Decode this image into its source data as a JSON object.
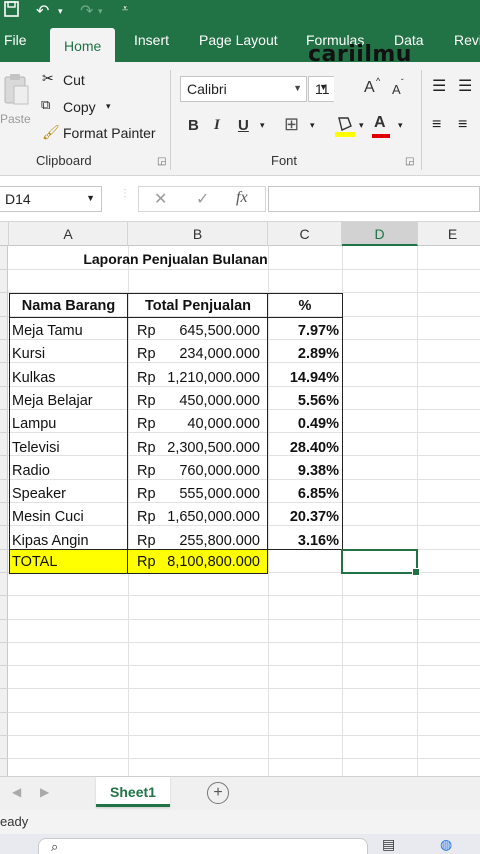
{
  "titlebar": {
    "save_icon": "save-icon",
    "undo_icon": "undo-icon",
    "redo_icon": "redo-icon",
    "customize_icon": "customize-qat-icon"
  },
  "tabs": [
    {
      "label": "File"
    },
    {
      "label": "Home"
    },
    {
      "label": "Insert"
    },
    {
      "label": "Page Layout"
    },
    {
      "label": "Formulas"
    },
    {
      "label": "Data"
    },
    {
      "label": "Revi"
    }
  ],
  "watermark": "cariilmu",
  "clipboard": {
    "paste_label": "Paste",
    "cut_label": "Cut",
    "copy_label": "Copy",
    "format_painter_label": "Format Painter",
    "group_label": "Clipboard"
  },
  "font": {
    "family": "Calibri",
    "size": "11",
    "grow_label": "A",
    "shrink_label": "A",
    "bold_label": "B",
    "italic_label": "I",
    "underline_label": "U",
    "font_color_label": "A",
    "group_label": "Font"
  },
  "formula_bar": {
    "name_box": "D14",
    "cancel_symbol": "✕",
    "enter_symbol": "✓",
    "fx_symbol": "fx",
    "value": ""
  },
  "columns": [
    "A",
    "B",
    "C",
    "D",
    "E"
  ],
  "sheet": {
    "title": "Laporan Penjualan Bulanan",
    "headers": {
      "name": "Nama Barang",
      "total": "Total Penjualan",
      "pct": "%"
    },
    "currency": "Rp",
    "rows": [
      {
        "name": "Meja Tamu",
        "amount": "645,500.000",
        "pct": "7.97%"
      },
      {
        "name": "Kursi",
        "amount": "234,000.000",
        "pct": "2.89%"
      },
      {
        "name": "Kulkas",
        "amount": "1,210,000.000",
        "pct": "14.94%"
      },
      {
        "name": "Meja Belajar",
        "amount": "450,000.000",
        "pct": "5.56%"
      },
      {
        "name": "Lampu",
        "amount": "40,000.000",
        "pct": "0.49%"
      },
      {
        "name": "Televisi",
        "amount": "2,300,500.000",
        "pct": "28.40%"
      },
      {
        "name": "Radio",
        "amount": "760,000.000",
        "pct": "9.38%"
      },
      {
        "name": "Speaker",
        "amount": "555,000.000",
        "pct": "6.85%"
      },
      {
        "name": "Mesin Cuci",
        "amount": "1,650,000.000",
        "pct": "20.37%"
      },
      {
        "name": "Kipas Angin",
        "amount": "255,800.000",
        "pct": "3.16%"
      }
    ],
    "total": {
      "label": "TOTAL",
      "amount": "8,100,800.000"
    },
    "highlight_color": "#ffff00"
  },
  "sheet_tabs": {
    "active": "Sheet1",
    "add_symbol": "+"
  },
  "status": {
    "text": "eady"
  },
  "taskbar": {
    "search_placeholder": ""
  },
  "colors": {
    "excel_green": "#217346",
    "ribbon_bg": "#f3f3f3",
    "font_color_red": "#e00000",
    "highlight_yellow": "#ffff00"
  }
}
